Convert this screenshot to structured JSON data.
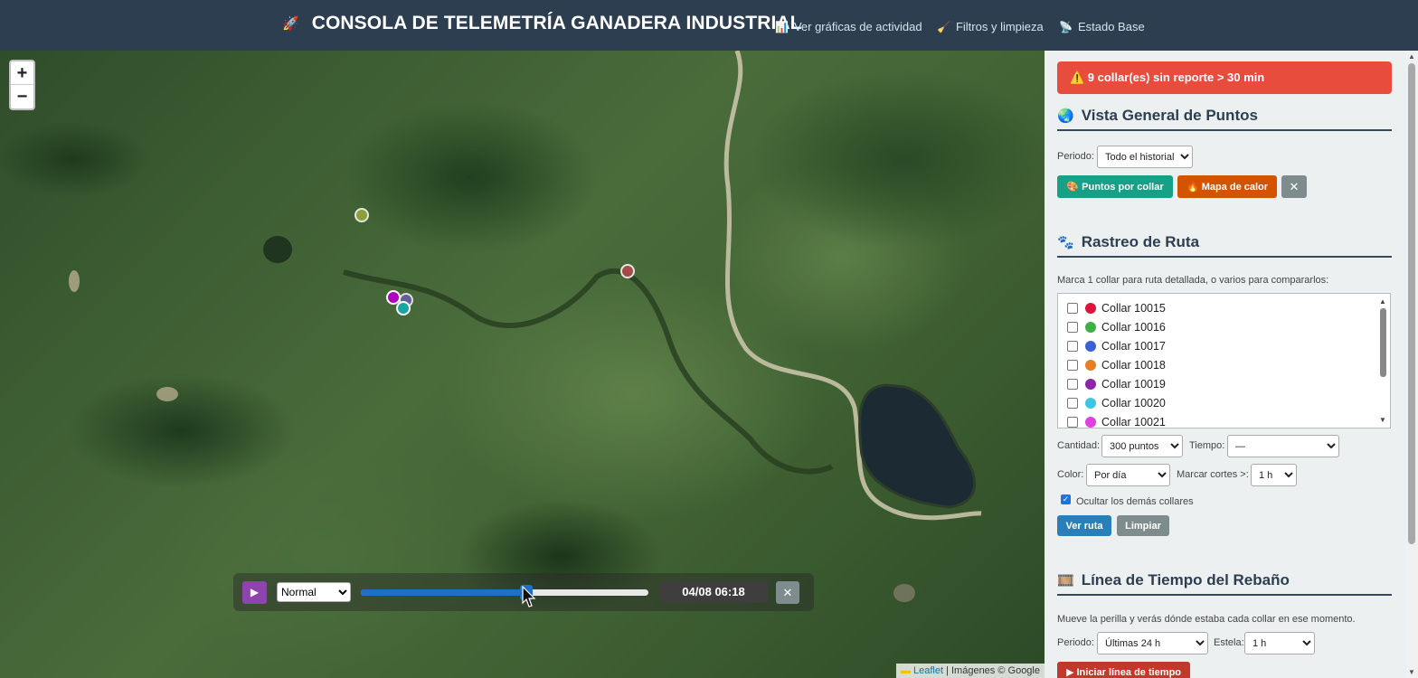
{
  "header": {
    "title_icon": "rocket-icon",
    "title": "CONSOLA DE TELEMETRÍA GANADERA INDUSTRIAL",
    "links": [
      {
        "icon": "bar-chart-icon",
        "label": "Ver gráficas de actividad"
      },
      {
        "icon": "broom-icon",
        "label": "Filtros y limpieza"
      },
      {
        "icon": "satellite-icon",
        "label": "Estado Base"
      }
    ]
  },
  "map": {
    "zoom_in": "+",
    "zoom_out": "−",
    "attribution_link": "Leaflet",
    "attribution_text": "| Imágenes © Google",
    "markers": [
      {
        "name": "marker-olive",
        "color": "#9aaa3a"
      },
      {
        "name": "marker-red",
        "color": "#b8484e"
      },
      {
        "name": "marker-magenta",
        "color": "#b000c0"
      },
      {
        "name": "marker-violet",
        "color": "#6b5bb0"
      },
      {
        "name": "marker-teal",
        "color": "#1aa5a0"
      }
    ]
  },
  "player": {
    "play_icon": "▶",
    "speed": "Normal",
    "progress": 0.575,
    "time": "04/08 06:18",
    "close": "✕"
  },
  "panel": {
    "alert": "⚠️ 9 collar(es) sin reporte > 30 min",
    "overview": {
      "icon": "globe-icon",
      "title": "Vista General de Puntos",
      "period_label": "Periodo:",
      "period_value": "Todo el historial",
      "btn_points": "🎨 Puntos por collar",
      "btn_heat": "🔥 Mapa de calor",
      "btn_close": "✕"
    },
    "route": {
      "icon": "paw-icon",
      "title": "Rastreo de Ruta",
      "hint": "Marca 1 collar para ruta detallada, o varios para compararlos:",
      "collars": [
        {
          "label": "Collar 10015",
          "color": "#dc143c"
        },
        {
          "label": "Collar 10016",
          "color": "#3cb043"
        },
        {
          "label": "Collar 10017",
          "color": "#3c5fd6"
        },
        {
          "label": "Collar 10018",
          "color": "#e67e22"
        },
        {
          "label": "Collar 10019",
          "color": "#8e24aa"
        },
        {
          "label": "Collar 10020",
          "color": "#3cc6e0"
        },
        {
          "label": "Collar 10021",
          "color": "#e040e0"
        }
      ],
      "qty_label": "Cantidad:",
      "qty_value": "300 puntos",
      "time_label": "Tiempo:",
      "time_value": "—",
      "color_label": "Color:",
      "color_value": "Por día",
      "cuts_label": "Marcar cortes >:",
      "cuts_value": "1 h",
      "hide_label": "Ocultar los demás collares",
      "hide_checked": true,
      "btn_view": "Ver ruta",
      "btn_clear": "Limpiar"
    },
    "timeline": {
      "icon": "film-icon",
      "title": "Línea de Tiempo del Rebaño",
      "hint": "Mueve la perilla y verás dónde estaba cada collar en ese momento.",
      "period_label": "Periodo:",
      "period_value": "Últimas 24 h",
      "trail_label": "Estela:",
      "trail_value": "1 h",
      "btn_start": "▶ Iniciar línea de tiempo"
    }
  }
}
